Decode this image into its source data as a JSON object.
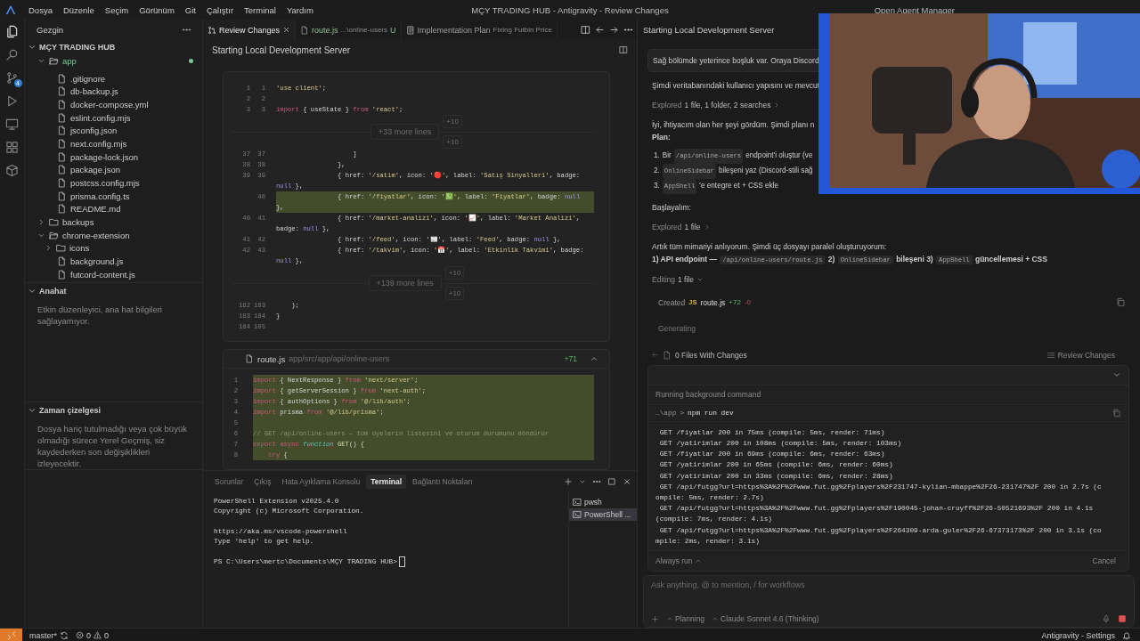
{
  "title_bar": {
    "menu": [
      "Dosya",
      "Düzenle",
      "Seçim",
      "Görünüm",
      "Git",
      "Çalıştır",
      "Terminal",
      "Yardım"
    ],
    "title": "MÇY TRADING HUB - Antigravity - Review Changes",
    "agent_manager": "Open Agent Manager"
  },
  "activity_bar": {
    "items": [
      {
        "kind": "explorer",
        "selected": true
      },
      {
        "kind": "search",
        "selected": false
      },
      {
        "kind": "source_control",
        "selected": false,
        "badge": "4"
      },
      {
        "kind": "run",
        "selected": false
      },
      {
        "kind": "remote",
        "selected": false
      },
      {
        "kind": "extensions",
        "selected": false
      },
      {
        "kind": "containers",
        "selected": false
      }
    ]
  },
  "sidebar": {
    "title": "Gezgin",
    "explorer": {
      "title": "MÇY TRADING HUB",
      "expanded": true,
      "tree": [
        {
          "name": "app",
          "kind": "folder",
          "expanded": true,
          "modified": true,
          "children": [
            {
              "name": ".gitignore",
              "kind": "file"
            },
            {
              "name": "db-backup.js",
              "kind": "file"
            },
            {
              "name": "docker-compose.yml",
              "kind": "file"
            },
            {
              "name": "eslint.config.mjs",
              "kind": "file"
            },
            {
              "name": "jsconfig.json",
              "kind": "file"
            },
            {
              "name": "next.config.mjs",
              "kind": "file"
            },
            {
              "name": "package-lock.json",
              "kind": "file"
            },
            {
              "name": "package.json",
              "kind": "file"
            },
            {
              "name": "postcss.config.mjs",
              "kind": "file"
            },
            {
              "name": "prisma.config.ts",
              "kind": "file"
            },
            {
              "name": "README.md",
              "kind": "file"
            }
          ]
        },
        {
          "name": "backups",
          "kind": "folder",
          "expanded": false,
          "modified": false
        },
        {
          "name": "chrome-extension",
          "kind": "folder",
          "expanded": true,
          "modified": false,
          "children": [
            {
              "name": "icons",
              "kind": "folder",
              "expanded": false,
              "modified": false
            },
            {
              "name": "background.js",
              "kind": "file"
            },
            {
              "name": "futcord-content.js",
              "kind": "file"
            }
          ]
        }
      ]
    },
    "outline": {
      "title": "Anahat",
      "expanded": true,
      "message": "Etkin düzenleyici, ana hat bilgileri sağlayamıyor."
    },
    "timeline": {
      "title": "Zaman çizelgesi",
      "expanded": true,
      "message": "Dosya hariç tutulmadığı veya çok büyük olmadığı sürece Yerel Geçmiş, siz kaydederken son değişiklikleri izleyecektir."
    }
  },
  "editor_tabs": [
    {
      "kind": "review",
      "label": "Review Changes",
      "selected": true
    },
    {
      "kind": "file",
      "label": "route.js",
      "description": "...\\online-users",
      "status": "U",
      "selected": false
    },
    {
      "kind": "plan",
      "label": "Implementation Plan",
      "description": "Fixing Futbin Price",
      "selected": false
    }
  ],
  "editor": {
    "heading": "Starting Local Development Server",
    "cards": [
      {
        "rows": [
          {
            "kind": "line",
            "old": "1",
            "new": "1",
            "added": false,
            "tokens": [
              {
                "kind": "s",
                "text": "'use client'"
              },
              {
                "kind": "p",
                "text": ";"
              }
            ]
          },
          {
            "kind": "line",
            "old": "2",
            "new": "2",
            "added": false
          },
          {
            "kind": "line",
            "old": "3",
            "new": "3",
            "added": false,
            "tokens": [
              {
                "kind": "kw",
                "text": "import"
              },
              {
                "kind": "p",
                "text": " { useState } "
              },
              {
                "kind": "kw",
                "text": "from"
              },
              {
                "kind": "s",
                "text": " 'react'"
              },
              {
                "kind": "p",
                "text": ";"
              }
            ]
          },
          {
            "kind": "fold",
            "label": "+33 more lines",
            "expand_up": "+10",
            "expand_down": "+10"
          },
          {
            "kind": "line",
            "old": "37",
            "new": "37",
            "added": false,
            "tokens": [
              {
                "kind": "p",
                "text": "                    ]"
              }
            ]
          },
          {
            "kind": "line",
            "old": "38",
            "new": "38",
            "added": false,
            "tokens": [
              {
                "kind": "p",
                "text": "                },"
              }
            ]
          },
          {
            "kind": "line",
            "old": "39",
            "new": "39",
            "added": false,
            "tokens": [
              {
                "kind": "p",
                "text": "                { href: "
              },
              {
                "kind": "s",
                "text": "'/satim'"
              },
              {
                "kind": "p",
                "text": ", icon: "
              },
              {
                "kind": "s",
                "text": "'🔴'"
              },
              {
                "kind": "p",
                "text": ", label: "
              },
              {
                "kind": "s",
                "text": "'Satış Sinyalleri'"
              },
              {
                "kind": "p",
                "text": ", badge: "
              },
              {
                "kind": "n",
                "text": "null"
              },
              {
                "kind": "p",
                "text": " },"
              }
            ]
          },
          {
            "kind": "line",
            "new": "40",
            "added": true,
            "tokens": [
              {
                "kind": "p",
                "text": "                { href: "
              },
              {
                "kind": "s",
                "text": "'/fiyatlar'"
              },
              {
                "kind": "p",
                "text": ", icon: "
              },
              {
                "kind": "s",
                "text": "'💹'"
              },
              {
                "kind": "p",
                "text": ", label: "
              },
              {
                "kind": "s",
                "text": "'Fiyatlar'"
              },
              {
                "kind": "p",
                "text": ", badge: "
              },
              {
                "kind": "n",
                "text": "null"
              },
              {
                "kind": "p",
                "text": " },"
              }
            ]
          },
          {
            "kind": "line",
            "old": "40",
            "new": "41",
            "added": false,
            "tokens": [
              {
                "kind": "p",
                "text": "                { href: "
              },
              {
                "kind": "s",
                "text": "'/market-analizi'"
              },
              {
                "kind": "p",
                "text": ", icon: "
              },
              {
                "kind": "s",
                "text": "'📈'"
              },
              {
                "kind": "p",
                "text": ", label: "
              },
              {
                "kind": "s",
                "text": "'Market Analizi'"
              },
              {
                "kind": "p",
                "text": ", badge: "
              },
              {
                "kind": "n",
                "text": "null"
              },
              {
                "kind": "p",
                "text": " },"
              }
            ]
          },
          {
            "kind": "line",
            "old": "41",
            "new": "42",
            "added": false,
            "tokens": [
              {
                "kind": "p",
                "text": "                { href: "
              },
              {
                "kind": "s",
                "text": "'/feed'"
              },
              {
                "kind": "p",
                "text": ", icon: "
              },
              {
                "kind": "s",
                "text": "'📰'"
              },
              {
                "kind": "p",
                "text": ", label: "
              },
              {
                "kind": "s",
                "text": "'Feed'"
              },
              {
                "kind": "p",
                "text": ", badge: "
              },
              {
                "kind": "n",
                "text": "null"
              },
              {
                "kind": "p",
                "text": " },"
              }
            ]
          },
          {
            "kind": "line",
            "old": "42",
            "new": "43",
            "added": false,
            "tokens": [
              {
                "kind": "p",
                "text": "                { href: "
              },
              {
                "kind": "s",
                "text": "'/takvim'"
              },
              {
                "kind": "p",
                "text": ", icon: "
              },
              {
                "kind": "s",
                "text": "'📅'"
              },
              {
                "kind": "p",
                "text": ", label: "
              },
              {
                "kind": "s",
                "text": "'Etkinlik Takvimi'"
              },
              {
                "kind": "p",
                "text": ", badge: "
              },
              {
                "kind": "n",
                "text": "null"
              },
              {
                "kind": "p",
                "text": " },"
              }
            ]
          },
          {
            "kind": "fold",
            "label": "+139 more lines",
            "expand_up": "+10",
            "expand_down": "+10"
          },
          {
            "kind": "line",
            "old": "182",
            "new": "183",
            "added": false,
            "tokens": [
              {
                "kind": "p",
                "text": "    );"
              }
            ]
          },
          {
            "kind": "line",
            "old": "183",
            "new": "184",
            "added": false,
            "tokens": [
              {
                "kind": "p",
                "text": "}"
              }
            ]
          },
          {
            "kind": "line",
            "old": "184",
            "new": "185",
            "added": false
          }
        ]
      },
      {
        "file": "route.js",
        "path": "app/src/app/api/online-users",
        "added_count": "+71",
        "expanded": true,
        "rows": [
          {
            "kind": "line",
            "new": "1",
            "added": true,
            "tokens": [
              {
                "kind": "kw",
                "text": "import"
              },
              {
                "kind": "p",
                "text": " { NextResponse } "
              },
              {
                "kind": "kw",
                "text": "from"
              },
              {
                "kind": "s",
                "text": " 'next/server'"
              },
              {
                "kind": "p",
                "text": ";"
              }
            ]
          },
          {
            "kind": "line",
            "new": "2",
            "added": true,
            "tokens": [
              {
                "kind": "kw",
                "text": "import"
              },
              {
                "kind": "p",
                "text": " { getServerSession } "
              },
              {
                "kind": "kw",
                "text": "from"
              },
              {
                "kind": "s",
                "text": " 'next-auth'"
              },
              {
                "kind": "p",
                "text": ";"
              }
            ]
          },
          {
            "kind": "line",
            "new": "3",
            "added": true,
            "tokens": [
              {
                "kind": "kw",
                "text": "import"
              },
              {
                "kind": "p",
                "text": " { authOptions } "
              },
              {
                "kind": "kw",
                "text": "from"
              },
              {
                "kind": "s",
                "text": " '@/lib/auth'"
              },
              {
                "kind": "p",
                "text": ";"
              }
            ]
          },
          {
            "kind": "line",
            "new": "4",
            "added": true,
            "tokens": [
              {
                "kind": "kw",
                "text": "import"
              },
              {
                "kind": "p",
                "text": " prisma "
              },
              {
                "kind": "kw",
                "text": "from"
              },
              {
                "kind": "s",
                "text": " '@/lib/prisma'"
              },
              {
                "kind": "p",
                "text": ";"
              }
            ]
          },
          {
            "kind": "line",
            "new": "5",
            "added": true
          },
          {
            "kind": "line",
            "new": "6",
            "added": true,
            "tokens": [
              {
                "kind": "c",
                "text": "// GET /api/online-users — tüm üyelerin listesini ve oturum durumunu döndürür"
              }
            ]
          },
          {
            "kind": "line",
            "new": "7",
            "added": true,
            "tokens": [
              {
                "kind": "kw",
                "text": "export"
              },
              {
                "kind": "kw",
                "text": " async"
              },
              {
                "kind": "fk",
                "text": " function"
              },
              {
                "kind": "f",
                "text": " GET"
              },
              {
                "kind": "p",
                "text": "() {"
              }
            ]
          },
          {
            "kind": "line",
            "new": "8",
            "added": true,
            "tokens": [
              {
                "kind": "kw",
                "text": "    try"
              },
              {
                "kind": "p",
                "text": " {"
              }
            ]
          }
        ]
      }
    ]
  },
  "panel": {
    "tabs": [
      {
        "label": "Sorunlar",
        "selected": false
      },
      {
        "label": "Çıkış",
        "selected": false
      },
      {
        "label": "Hata Ayıklama Konsolu",
        "selected": false
      },
      {
        "label": "Terminal",
        "selected": true
      },
      {
        "label": "Bağlantı Noktaları",
        "selected": false
      }
    ],
    "output_groups": [
      [
        "PowerShell Extension v2025.4.0",
        "Copyright (c) Microsoft Corporation."
      ],
      [
        "https://aka.ms/vscode-powershell",
        "Type 'help' to get help."
      ]
    ],
    "prompt": "PS C:\\Users\\mertc\\Documents\\MÇY TRADING HUB>",
    "terminals": [
      {
        "label": "pwsh",
        "selected": false
      },
      {
        "label": "PowerShell ...",
        "selected": true
      }
    ]
  },
  "agent": {
    "heading": "Starting Local Development Server",
    "conversation": [
      {
        "kind": "user_message",
        "text": "Sağ bölümde yeterince boşluk var. Oraya Discord"
      },
      {
        "kind": "paragraph",
        "segments": [
          {
            "text": "Şimdi veritabanındaki kullanıcı yapısını ve mevcut"
          }
        ]
      },
      {
        "kind": "step",
        "label": "Explored",
        "detail": "1 file, 1 folder, 2 searches",
        "expanded": false
      },
      {
        "kind": "paragraph",
        "segments": [
          {
            "text": "İyi, ihtiyacım olan her şeyi gördüm. Şimdi planı n"
          }
        ]
      },
      {
        "kind": "heading",
        "text": "Plan:"
      },
      {
        "kind": "list",
        "items": [
          {
            "number": "1.",
            "segments": [
              {
                "text": "Bir "
              },
              {
                "code": "/api/online-users"
              },
              {
                "text": " endpoint'i oluştur (ve"
              }
            ]
          },
          {
            "number": "2.",
            "segments": [
              {
                "code": "OnlineSidebar"
              },
              {
                "text": " bileşeni yaz (Discord-stili sağ"
              }
            ]
          },
          {
            "number": "3.",
            "segments": [
              {
                "code": "AppShell"
              },
              {
                "text": " 'e entegre et + CSS ekle"
              }
            ]
          }
        ]
      },
      {
        "kind": "paragraph",
        "segments": [
          {
            "text": "Başlayalım:"
          }
        ]
      },
      {
        "kind": "step",
        "label": "Explored",
        "detail": "1 file",
        "expanded": false
      },
      {
        "kind": "paragraph",
        "segments": [
          {
            "text": "Artık tüm mimariyi anlıyorum. Şimdi üç dosyayı paralel oluşturuyorum:"
          }
        ]
      },
      {
        "kind": "bold_line",
        "segments": [
          {
            "text": "1) API endpoint — "
          },
          {
            "code": "/api/online-users/route.js"
          },
          {
            "text": " 2) "
          },
          {
            "code": "OnlineSidebar"
          },
          {
            "text": " bileşeni 3) "
          },
          {
            "code": "AppShell"
          },
          {
            "text": " güncellemesi + CSS"
          }
        ]
      },
      {
        "kind": "step",
        "label": "Editing",
        "detail": "1 file",
        "expanded": true
      },
      {
        "kind": "file_action",
        "label": "Created",
        "file": "route.js",
        "file_badge": "JS",
        "added": "+72",
        "removed": "-0"
      },
      {
        "kind": "status",
        "text": "Generating"
      }
    ],
    "changes": {
      "label": "0 Files With Changes",
      "review": "Review Changes"
    },
    "command": {
      "expanded": true,
      "title": "Running background command",
      "cwd": "…\\app",
      "separator": ">",
      "command": "npm run dev",
      "output": [
        " GET /fiyatlar 200 in 75ms (compile: 5ms, render: 71ms)",
        " GET /yatirimlar 200 in 108ms (compile: 5ms, render: 103ms)",
        " GET /fiyatlar 200 in 69ms (compile: 6ms, render: 63ms)",
        " GET /yatirimlar 200 in 65ms (compile: 6ms, render: 60ms)",
        " GET /yatirimlar 200 in 33ms (compile: 6ms, render: 28ms)",
        " GET /api/futgg?url=https%3A%2F%2Fwww.fut.gg%2Fplayers%2F231747-kylian-mbappe%2F26-231747%2F 200 in 2.7s (compile: 5ms, render: 2.7s)",
        " GET /api/futgg?url=https%3A%2F%2Fwww.fut.gg%2Fplayers%2F190045-johan-cruyff%2F26-50521693%2F 200 in 4.1s (compile: 7ms, render: 4.1s)",
        " GET /api/futgg?url=https%3A%2F%2Fwww.fut.gg%2Fplayers%2F264309-arda-guler%2F26-67373173%2F 200 in 3.1s (compile: 2ms, render: 3.1s)"
      ],
      "always_run": "Always run",
      "cancel": "Cancel"
    },
    "input": {
      "placeholder": "Ask anything, @ to mention, / for workflows",
      "mode": "Planning",
      "model": "Claude Sonnet 4.6 (Thinking)",
      "running": true
    }
  },
  "status_bar": {
    "branch": "master*",
    "errors": "0",
    "warnings": "0",
    "right": "Antigravity - Settings"
  }
}
